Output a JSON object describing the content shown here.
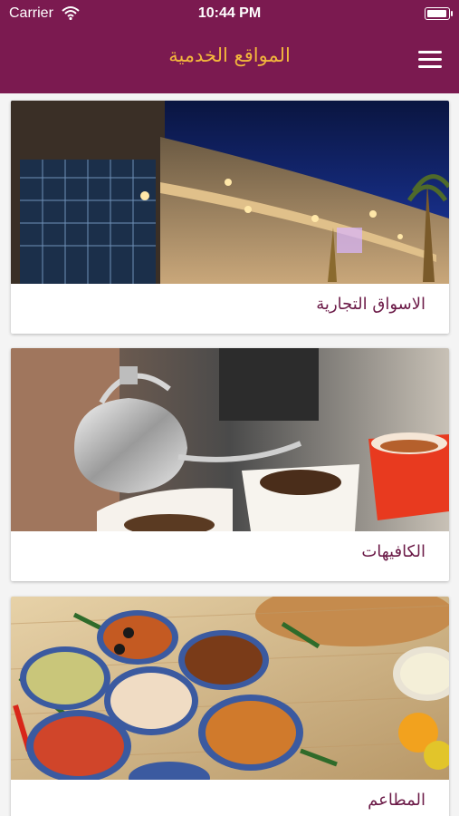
{
  "status": {
    "carrier": "Carrier",
    "time": "10:44 PM"
  },
  "header": {
    "title": "المواقع الخدمية",
    "menu_icon": "hamburger-menu-icon"
  },
  "colors": {
    "brand": "#7b1a50",
    "title": "#f3b73c",
    "label": "#6b1a47"
  },
  "cards": [
    {
      "label": "الاسواق التجارية",
      "image": "shopping-mall-photo"
    },
    {
      "label": "الكافيهات",
      "image": "coffee-pouring-photo"
    },
    {
      "label": "المطاعم",
      "image": "traditional-food-photo"
    }
  ]
}
